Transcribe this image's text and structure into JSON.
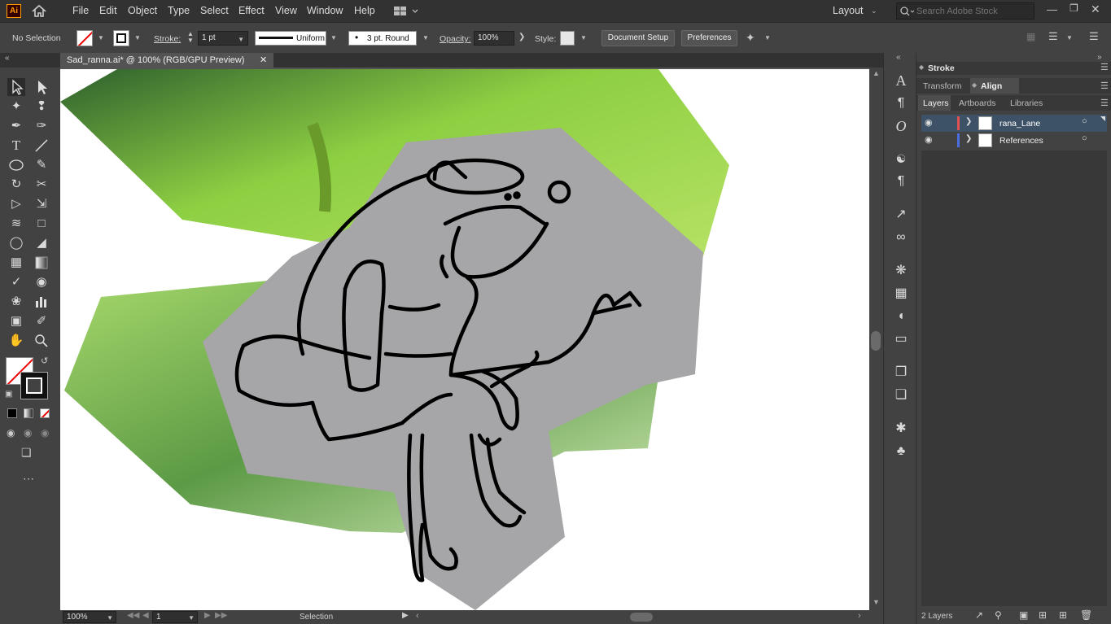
{
  "app": {
    "logo": "Ai",
    "icon": "home-icon"
  },
  "menu": [
    "File",
    "Edit",
    "Object",
    "Type",
    "Select",
    "Effect",
    "View",
    "Window",
    "Help"
  ],
  "workspace": {
    "label": "Layout",
    "search_placeholder": "Search Adobe Stock"
  },
  "control": {
    "selection": "No Selection",
    "stroke_label": "Stroke:",
    "stroke_weight": "1 pt",
    "profile": "Uniform",
    "brush": "3 pt. Round",
    "opacity_label": "Opacity:",
    "opacity": "100%",
    "style_label": "Style:",
    "document_setup": "Document Setup",
    "preferences": "Preferences"
  },
  "document": {
    "tab_title": "Sad_ranna.ai* @ 100% (RGB/GPU Preview)"
  },
  "status": {
    "zoom": "100%",
    "artboard": "1",
    "tool": "Selection"
  },
  "panels": {
    "stroke": "Stroke",
    "transform": "Transform",
    "align": "Align",
    "layers_tab": "Layers",
    "artboards_tab": "Artboards",
    "libraries_tab": "Libraries",
    "layers": [
      {
        "name": "rana_Lane",
        "color": "#e05252"
      },
      {
        "name": "References",
        "color": "#4a6ee0"
      }
    ],
    "footer": "2 Layers"
  },
  "colors": {
    "accent": "#ff9a00",
    "selection_row": "#3a4a5a",
    "artboard": "#ffffff"
  }
}
